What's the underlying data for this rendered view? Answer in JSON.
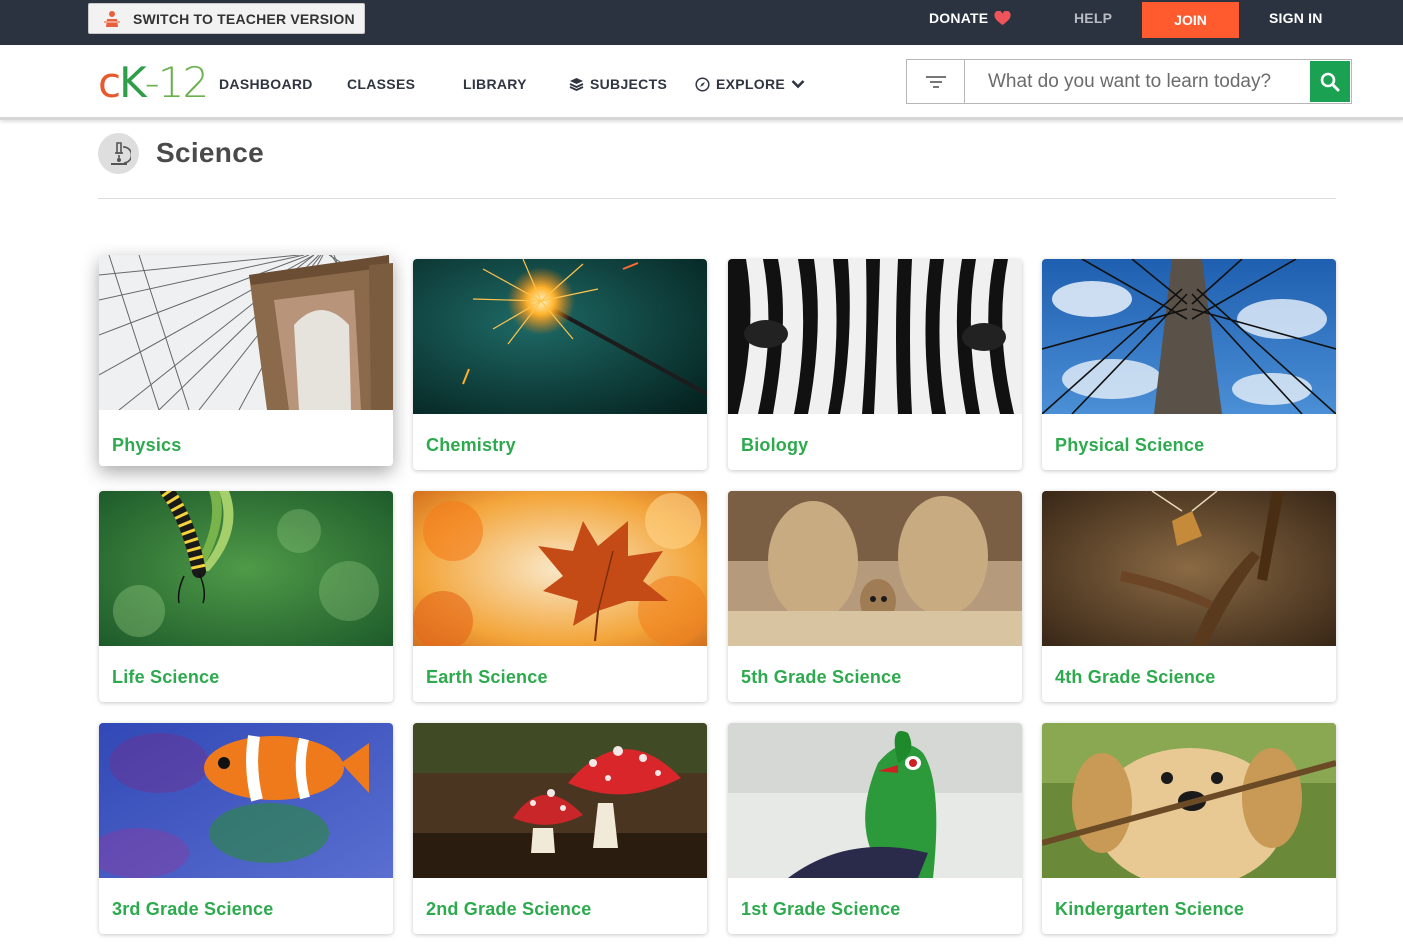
{
  "topbar": {
    "teacher_switch": "SWITCH TO TEACHER VERSION",
    "donate": "DONATE",
    "help": "HELP",
    "join": "JOIN",
    "sign_in": "SIGN IN"
  },
  "logo": {
    "c": "c",
    "k": "K",
    "dash12": "-12"
  },
  "nav": {
    "dashboard": "DASHBOARD",
    "classes": "CLASSES",
    "library": "LIBRARY",
    "subjects": "SUBJECTS",
    "explore": "EXPLORE"
  },
  "search": {
    "placeholder": "What do you want to learn today?"
  },
  "page": {
    "title": "Science"
  },
  "colors": {
    "accent_green": "#2eaa4e",
    "join_orange": "#ff5b2e",
    "topbar": "#2b3240"
  },
  "subjects": [
    {
      "label": "Physics",
      "icon": "bridge-photo"
    },
    {
      "label": "Chemistry",
      "icon": "sparkler-photo"
    },
    {
      "label": "Biology",
      "icon": "zebra-photo"
    },
    {
      "label": "Physical Science",
      "icon": "power-pole-photo"
    },
    {
      "label": "Life Science",
      "icon": "caterpillar-photo"
    },
    {
      "label": "Earth Science",
      "icon": "autumn-leaf-photo"
    },
    {
      "label": "5th Grade Science",
      "icon": "meerkat-photo"
    },
    {
      "label": "4th Grade Science",
      "icon": "dragonfly-photo"
    },
    {
      "label": "3rd Grade Science",
      "icon": "clownfish-photo"
    },
    {
      "label": "2nd Grade Science",
      "icon": "mushroom-photo"
    },
    {
      "label": "1st Grade Science",
      "icon": "green-bird-photo"
    },
    {
      "label": "Kindergarten Science",
      "icon": "puppy-photo"
    }
  ]
}
